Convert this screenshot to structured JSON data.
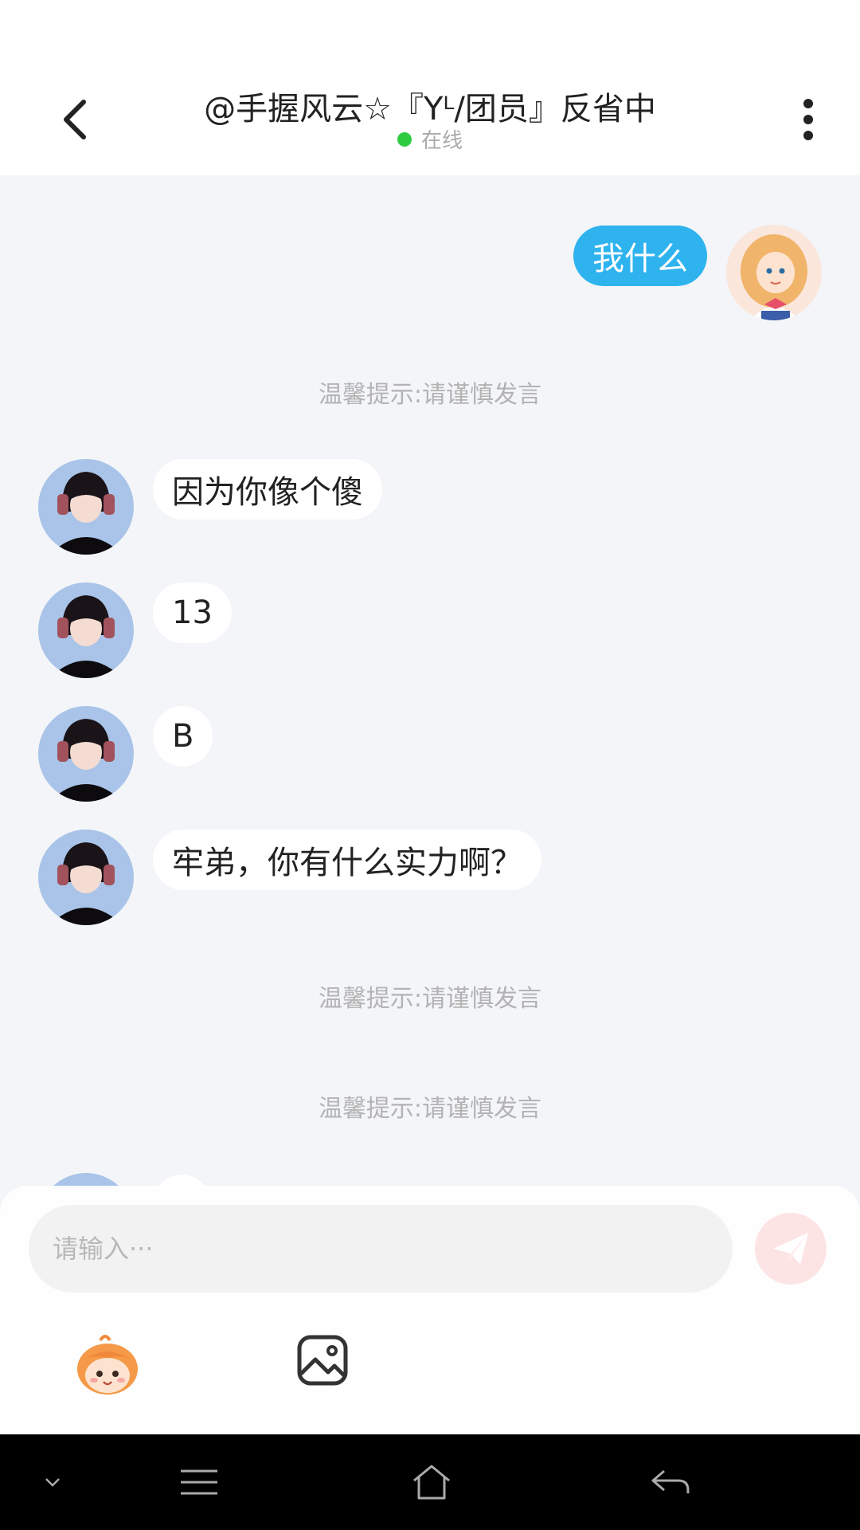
{
  "header": {
    "title": "@手握风云☆『Yᴸ/团员』反省中",
    "status": "在线",
    "status_color": "#2ecc40"
  },
  "messages": [
    {
      "side": "right",
      "text": "我什么"
    },
    {
      "type": "tip",
      "text": "温馨提示:请谨慎发言"
    },
    {
      "side": "left",
      "text": "因为你像个傻"
    },
    {
      "side": "left",
      "text": "13"
    },
    {
      "side": "left",
      "text": "B"
    },
    {
      "side": "left",
      "text": "牢弟，你有什么实力啊？"
    },
    {
      "type": "tip",
      "text": "温馨提示:请谨慎发言"
    },
    {
      "type": "tip",
      "text": "温馨提示:请谨慎发言"
    }
  ],
  "composer": {
    "placeholder": "请输入···"
  },
  "icons": {
    "back": "chevron-left-icon",
    "more": "more-vertical-icon",
    "send": "paper-plane-icon",
    "emoji": "emoji-mascot-icon",
    "image": "image-icon"
  },
  "colors": {
    "my_bubble": "#2fb3ef",
    "their_bubble": "#ffffff",
    "background": "#f3f5f8",
    "send_button": "#fde4e4"
  }
}
